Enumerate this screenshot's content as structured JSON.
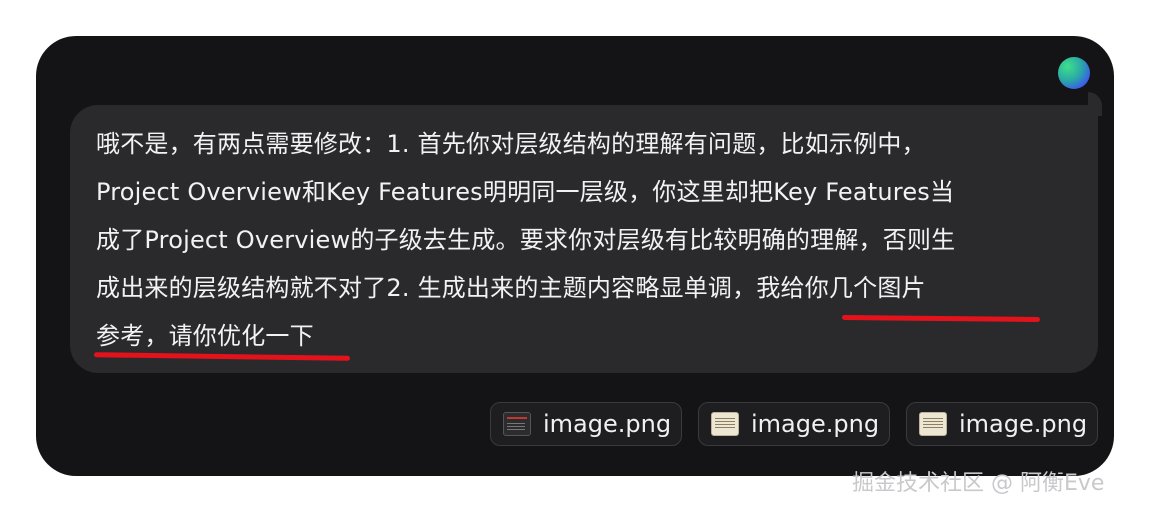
{
  "avatar": {
    "icon": "gradient-avatar-icon",
    "colors": [
      "#3fe08a",
      "#3a5fe8"
    ]
  },
  "message": {
    "lines": [
      "哦不是，有两点需要修改：1. 首先你对层级结构的理解有问题，比如示例中，",
      "Project Overview和Key Features明明同一层级，你这里却把Key Features当",
      "成了Project Overview的子级去生成。要求你对层级有比较明确的理解，否则生",
      "成出来的层级结构就不对了2. 生成出来的主题内容略显单调，我给你几个图片",
      "参考，请你优化一下"
    ],
    "highlight_color": "#e4131b"
  },
  "attachments": [
    {
      "name": "image.png",
      "thumb": "dark-screenshot-thumbnail-icon"
    },
    {
      "name": "image.png",
      "thumb": "light-document-thumbnail-icon"
    },
    {
      "name": "image.png",
      "thumb": "light-document-thumbnail-icon"
    }
  ],
  "watermark": "掘金技术社区 @ 阿衡Eve"
}
